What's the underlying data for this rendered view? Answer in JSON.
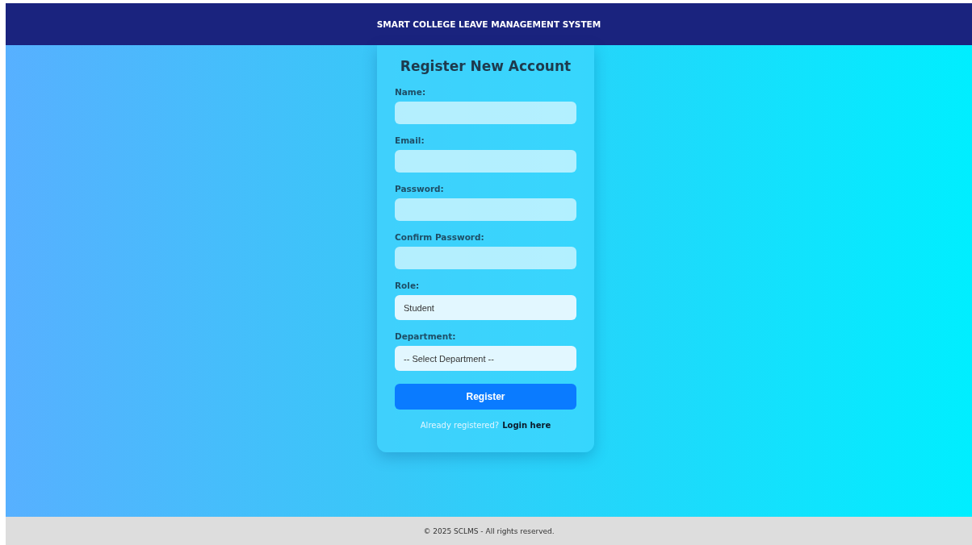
{
  "header": {
    "title": "SMART COLLEGE LEAVE MANAGEMENT SYSTEM"
  },
  "form": {
    "title": "Register New Account",
    "fields": [
      {
        "label": "Name:",
        "kind": "text"
      },
      {
        "label": "Email:",
        "kind": "text"
      },
      {
        "label": "Password:",
        "kind": "text"
      },
      {
        "label": "Confirm Password:",
        "kind": "text"
      },
      {
        "label": "Role:",
        "kind": "select",
        "value": "Student"
      },
      {
        "label": "Department:",
        "kind": "select",
        "value": "-- Select Department --"
      }
    ],
    "submit": "Register",
    "prompt": "Already registered?",
    "link": "Login here"
  },
  "footer": "© 2025 SCLMS - All rights reserved."
}
